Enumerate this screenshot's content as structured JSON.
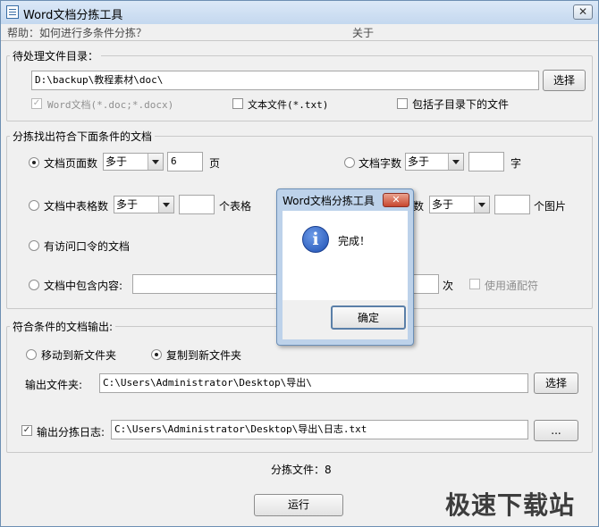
{
  "window": {
    "title": "Word文档分拣工具"
  },
  "menu": {
    "help": "帮助：如何进行多条件分拣？",
    "about": "关于"
  },
  "pending_group": {
    "legend": "待处理文件目录：",
    "dir_value": "D:\\backup\\教程素材\\doc\\",
    "select_label": "选择",
    "types": [
      {
        "label": "Word文档(*.doc;*.docx)",
        "checked": true,
        "disabled": true
      },
      {
        "label": "文本文件(*.txt)",
        "checked": false
      },
      {
        "label": "包括子目录下的文件",
        "checked": false
      }
    ]
  },
  "conditions_group": {
    "legend": "分拣找出符合下面条件的文档",
    "page_count": {
      "label": "文档页面数",
      "op": "多于",
      "value": "6",
      "unit": "页",
      "selected": true
    },
    "word_count": {
      "label": "文档字数",
      "op": "多于",
      "value": "",
      "unit": "字"
    },
    "table_count": {
      "label": "文档中表格数",
      "op": "多于",
      "value": "",
      "unit": "个表格"
    },
    "image_count": {
      "label_tail": "数",
      "op": "多于",
      "value": "",
      "unit": "个图片"
    },
    "password": {
      "label": "有访问口令的文档"
    },
    "contains": {
      "label": "文档中包含内容:",
      "value": "",
      "unit": "次",
      "wildcard": "使用通配符"
    }
  },
  "output_group": {
    "legend": "符合条件的文档输出:",
    "move_label": "移动到新文件夹",
    "copy_label": "复制到新文件夹",
    "folder_label": "输出文件夹:",
    "folder_value": "C:\\Users\\Administrator\\Desktop\\导出\\",
    "folder_select": "选择",
    "log_label": "输出分拣日志:",
    "log_value": "C:\\Users\\Administrator\\Desktop\\导出\\日志.txt",
    "log_browse": "..."
  },
  "status": {
    "sorted_files": "分拣文件：8"
  },
  "run_button": "运行",
  "dialog": {
    "title": "Word文档分拣工具",
    "close": "✕",
    "message": "完成！",
    "ok": "确定"
  },
  "watermark": "极速下载站"
}
